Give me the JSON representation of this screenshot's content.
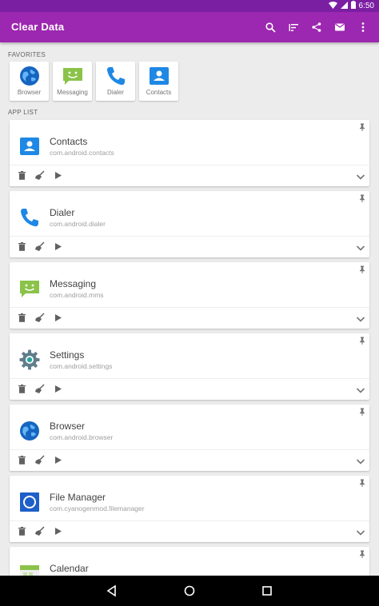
{
  "status_bar": {
    "time": "6:50"
  },
  "app_bar": {
    "title": "Clear Data"
  },
  "favorites": {
    "label": "FAVORITES",
    "items": [
      {
        "label": "Browser",
        "icon": "browser-globe-icon"
      },
      {
        "label": "Messaging",
        "icon": "messaging-icon"
      },
      {
        "label": "Dialer",
        "icon": "phone-icon"
      },
      {
        "label": "Contacts",
        "icon": "contacts-icon"
      }
    ]
  },
  "app_list": {
    "label": "APP LIST",
    "items": [
      {
        "name": "Contacts",
        "package": "com.android.contacts",
        "icon": "contacts-icon"
      },
      {
        "name": "Dialer",
        "package": "com.android.dialer",
        "icon": "phone-icon"
      },
      {
        "name": "Messaging",
        "package": "com.android.mms",
        "icon": "messaging-icon"
      },
      {
        "name": "Settings",
        "package": "com.android.settings",
        "icon": "gear-icon"
      },
      {
        "name": "Browser",
        "package": "com.android.browser",
        "icon": "browser-globe-icon"
      },
      {
        "name": "File Manager",
        "package": "com.cyanogenmod.filemanager",
        "icon": "file-manager-icon"
      },
      {
        "name": "Calendar",
        "package": "",
        "icon": "calendar-icon"
      }
    ]
  },
  "colors": {
    "status_bar": "#7b1fa2",
    "app_bar": "#9c27b0",
    "background": "#ececec",
    "card": "#ffffff"
  }
}
